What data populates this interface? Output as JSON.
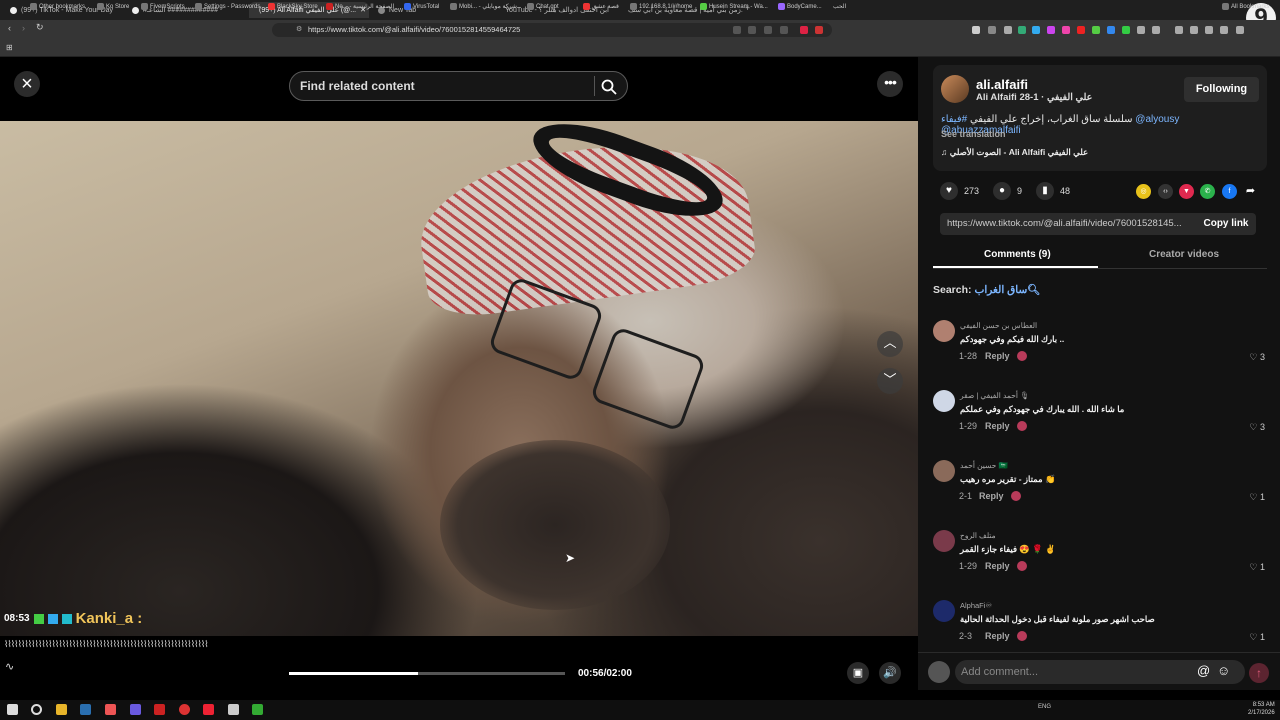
{
  "browser": {
    "tabs": [
      {
        "label": "(99+) TikTok - Make Your Day",
        "active": false
      },
      {
        "label": "#الشاعـ #############",
        "active": false
      },
      {
        "label": "(99+) Ali Alfaifi علي الفيفي (@...",
        "active": true
      },
      {
        "label": "New Tab",
        "active": false
      },
      {
        "label": "YouTube - ابن اختفى ادوالف هتلر ؟",
        "active": false
      },
      {
        "label": "زمن بني أمية | قصة معاوية بن أبي سف...",
        "active": false
      }
    ],
    "url": "https://www.tiktok.com/@ali.alfaifi/video/7600152814559464725",
    "bookmarks": [
      "Other bookmarks",
      "Ko Store",
      "FivemScripts",
      "Settings - Passwords",
      "BlackSky Store",
      "Ne... - الصفحة الرئيسية",
      "VirusTotal",
      "Mobi... - شركة موبايلي",
      "Chat gpt",
      "قصة عشق",
      "192.168.8.1/#/home",
      "Husein Stream - Wa...",
      "BodyCame...",
      "الحب"
    ],
    "all_bookmarks": "All Bookmarks"
  },
  "video": {
    "search_placeholder": "Find related content",
    "chat_time": "08:53",
    "chat_user": "Kanki_a :",
    "waveform": "⌇⌇⌇⌇⌇⌇⌇⌇⌇⌇⌇⌇⌇⌇⌇⌇⌇⌇⌇⌇⌇⌇⌇⌇⌇⌇⌇⌇⌇⌇⌇⌇⌇⌇⌇⌇⌇⌇⌇⌇⌇⌇⌇⌇⌇⌇⌇⌇⌇⌇⌇⌇⌇⌇⌇⌇⌇⌇⌇⌇",
    "progress_fraction": 0.466,
    "time": "00:56/02:00"
  },
  "author": {
    "handle": "ali.alfaifi",
    "name_line": "Ali Alfaifi علي الفيفي · 1-28",
    "follow_label": "Following",
    "description_prefix": "سلسلة ساق الغراب، إخراج علي الفيفي ",
    "description_tag": "#فيفاء @alyousy @abuazzamalfaifi",
    "see_translation": "See translation",
    "music": "♫  الصوت الأصلي - Ali Alfaifi علي الفيفي"
  },
  "stats": {
    "likes": "273",
    "comments": "9",
    "saves": "48"
  },
  "link": {
    "url": "https://www.tiktok.com/@ali.alfaifi/video/76001528145...",
    "copy_label": "Copy link"
  },
  "tabs": {
    "comments": "Comments (9)",
    "creator_videos": "Creator videos"
  },
  "comment_search": {
    "prefix": "Search:",
    "term": "ساق الغراب"
  },
  "comments": [
    {
      "name": "العطاس بن حسن الفيفي",
      "text": "بارك الله فيكم وفي جهودكم ..",
      "date": "1-28",
      "reply": "Reply",
      "likes": "3",
      "avatar_color": "#b08070"
    },
    {
      "name": "أحمد الفيفي | صقر 🎙",
      "text": "ما شاء الله . الله يبارك في جهودكم وفي عملكم",
      "date": "1-29",
      "reply": "Reply",
      "likes": "3",
      "avatar_color": "#cfd7e6"
    },
    {
      "name": "حسين أحمد 🇸🇦",
      "text": "ممتاز - تقرير مره رهيب 👏",
      "date": "2-1",
      "reply": "Reply",
      "likes": "1",
      "avatar_color": "#8a6a5a"
    },
    {
      "name": "متلف الروح",
      "text": "فيفاء جازء القمر 😍 🌹 ✌",
      "date": "1-29",
      "reply": "Reply",
      "likes": "1",
      "avatar_color": "#7a3a4a"
    },
    {
      "name": "AlphaFi♾",
      "text": "صاحب اشهر صور ملونة لفيفاء قبل دخول الحداثة الحالية",
      "date": "2-3",
      "reply": "Reply",
      "likes": "1",
      "avatar_color": "#1d2a6a"
    }
  ],
  "comment_input_placeholder": "Add comment...",
  "clock": {
    "time": "8:53 AM",
    "date": "2/17/2026"
  },
  "tray": "ENG"
}
